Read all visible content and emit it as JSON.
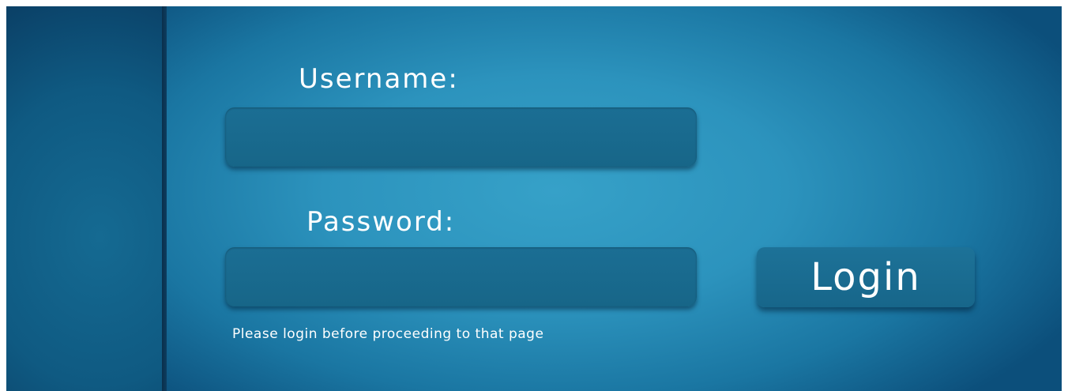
{
  "login_form": {
    "username_label": "Username:",
    "username_value": "",
    "password_label": "Password:",
    "password_value": "",
    "login_button_label": "Login",
    "hint_text": "Please login before proceeding to that page"
  },
  "colors": {
    "background_accent": "#2c93bd",
    "field_fill": "#1b6e94",
    "text": "#ffffff"
  }
}
